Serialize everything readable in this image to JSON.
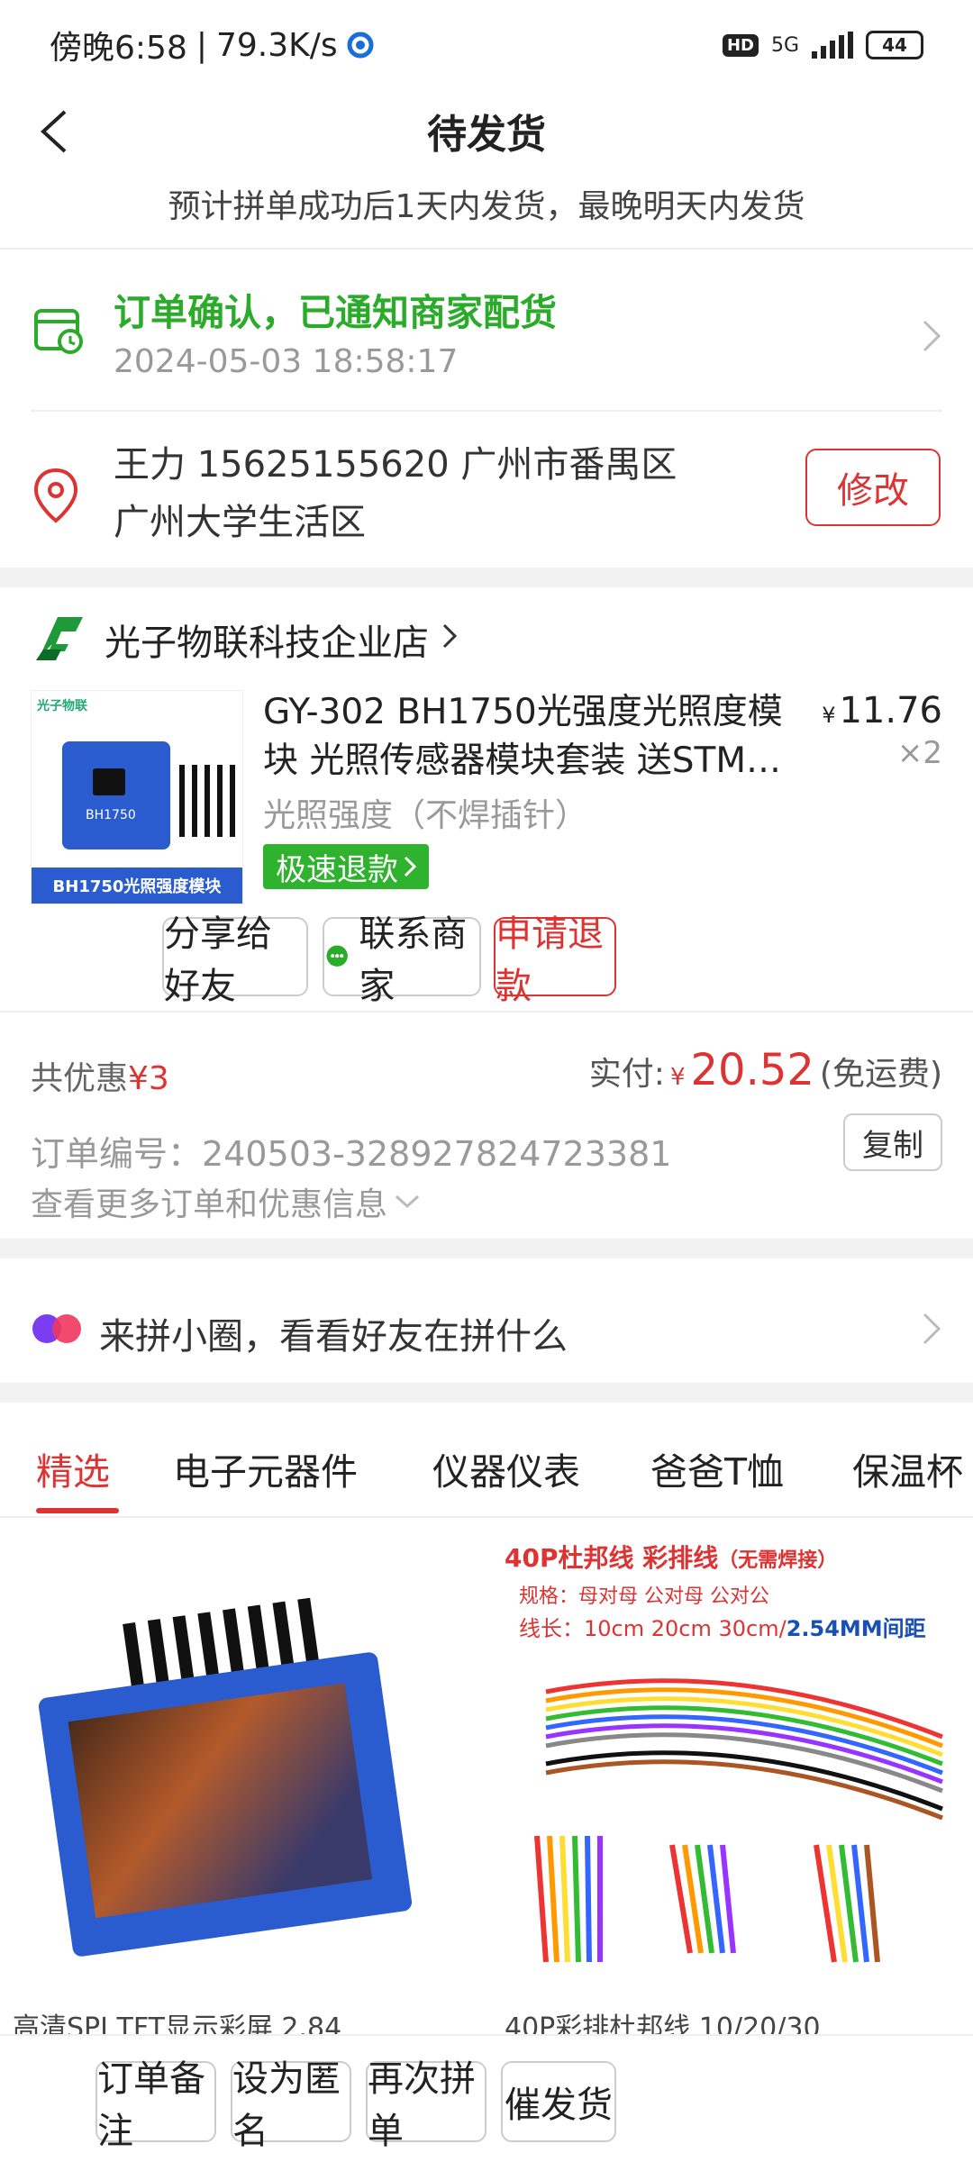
{
  "status_bar": {
    "time": "傍晚6:58",
    "speed": "79.3K/s",
    "hd": "HD",
    "network": "5G",
    "battery": "44"
  },
  "header": {
    "title": "待发货",
    "subtitle": "预计拼单成功后1天内发货，最晚明天内发货"
  },
  "order_status": {
    "text": "订单确认，已通知商家配货",
    "time": "2024-05-03 18:58:17"
  },
  "address": {
    "line1": "王力  15625155620  广州市番禺区",
    "line2": "广州大学生活区",
    "modify_label": "修改"
  },
  "shop": {
    "name": "光子物联科技企业店"
  },
  "product": {
    "title": "GY-302 BH1750光强度光照度模块 光照传感器模块套装 送STM…",
    "price_currency": "¥",
    "price": "11.76",
    "qty": "×2",
    "spec": "光照强度（不焊插针）",
    "refund_tag": "极速退款",
    "image_brand": "光子物联",
    "image_chip": "BH1750",
    "image_label": "BH1750光照强度模块"
  },
  "actions": {
    "share": "分享给好友",
    "contact": "联系商家",
    "refund": "申请退款"
  },
  "totals": {
    "discount_label": "共优惠",
    "discount_value": "¥3",
    "paid_label": "实付:",
    "paid_currency": "¥",
    "paid_amount": "20.52",
    "shipping_note": "(免运费)"
  },
  "order": {
    "number_label": "订单编号：",
    "number": "240503-328927824723381",
    "copy_label": "复制",
    "more_info": "查看更多订单和优惠信息"
  },
  "circle": {
    "text": "来拼小圈，看看好友在拼什么"
  },
  "tabs": [
    "精选",
    "电子元器件",
    "仪器仪表",
    "爸爸T恤",
    "保温杯"
  ],
  "recommend": {
    "left_meta": "高清SPI TFT显示彩屏 2.84",
    "right_title": "40P杜邦线 彩排线",
    "right_note": "（无需焊接）",
    "right_l2": "规格：母对母 公对母 公对公",
    "right_l3_a": "线长：10cm 20cm 30cm/",
    "right_l3_b": "2.54MM间距",
    "right_meta": "40P彩排杜邦线 10/20/30 "
  },
  "bottom": {
    "note": "订单备注",
    "anon": "设为匿名",
    "again": "再次拼单",
    "urge": "催发货"
  },
  "colors": {
    "accent_red": "#d33333",
    "green": "#2aab2a"
  }
}
